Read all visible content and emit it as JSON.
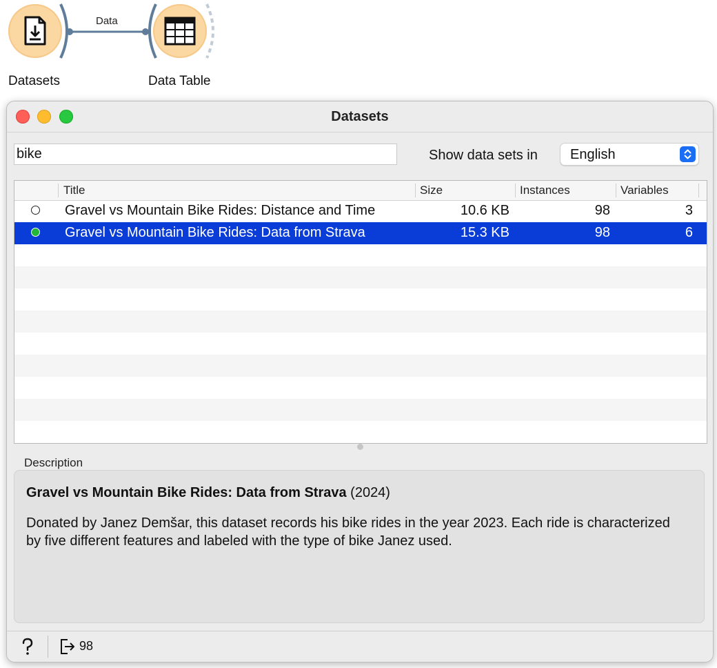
{
  "workflow": {
    "nodes": [
      {
        "label": "Datasets",
        "icon": "file-download-icon"
      },
      {
        "label": "Data Table",
        "icon": "table-grid-icon"
      }
    ],
    "link_label": "Data",
    "node_color": "#fbd7a1"
  },
  "window": {
    "title": "Datasets"
  },
  "filter": {
    "search_value": "bike",
    "language_label": "Show data sets in",
    "language_value": "English"
  },
  "table": {
    "columns": [
      "Title",
      "Size",
      "Instances",
      "Variables"
    ],
    "rows": [
      {
        "title": "Gravel vs Mountain Bike Rides: Distance and Time",
        "size": "10.6 KB",
        "instances": "98",
        "variables": "3",
        "selected": false
      },
      {
        "title": "Gravel vs Mountain Bike Rides: Data from Strava",
        "size": "15.3 KB",
        "instances": "98",
        "variables": "6",
        "selected": true
      }
    ],
    "selection_color": "#0a3cd8"
  },
  "description": {
    "label": "Description",
    "title": "Gravel vs Mountain Bike Rides: Data from Strava",
    "year": "(2024)",
    "text": "Donated by Janez Demšar, this dataset records his bike rides in the year 2023. Each ride is characterized by five different features and labeled with the type of bike Janez used."
  },
  "status": {
    "output_count": "98",
    "help_icon": "question-mark-icon",
    "output_icon": "output-arrow-icon"
  }
}
